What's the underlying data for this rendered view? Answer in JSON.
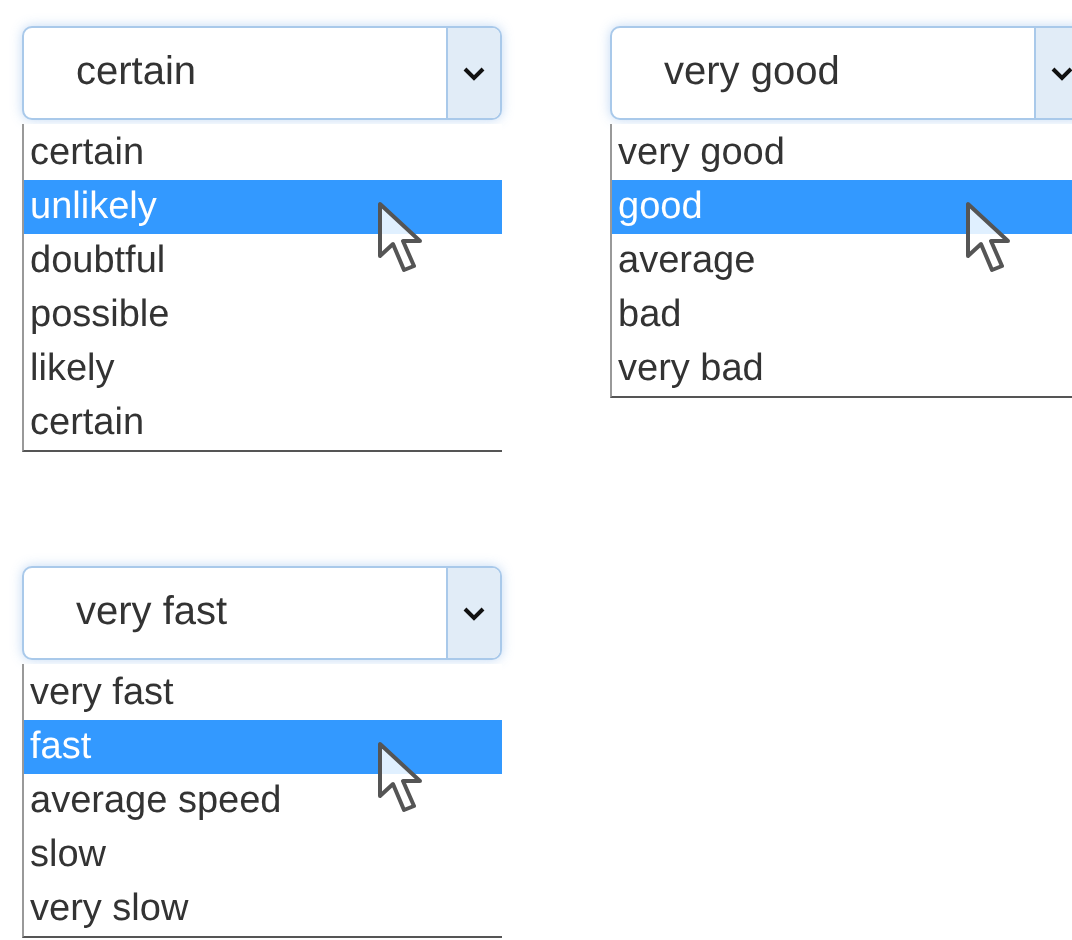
{
  "dropdowns": [
    {
      "value": "certain",
      "options": [
        {
          "label": "certain",
          "highlighted": false
        },
        {
          "label": "unlikely",
          "highlighted": true
        },
        {
          "label": "doubtful",
          "highlighted": false
        },
        {
          "label": "possible",
          "highlighted": false
        },
        {
          "label": "likely",
          "highlighted": false
        },
        {
          "label": "certain",
          "highlighted": false
        }
      ]
    },
    {
      "value": "very good",
      "options": [
        {
          "label": "very good",
          "highlighted": false
        },
        {
          "label": "good",
          "highlighted": true
        },
        {
          "label": "average",
          "highlighted": false
        },
        {
          "label": "bad",
          "highlighted": false
        },
        {
          "label": "very bad",
          "highlighted": false
        }
      ]
    },
    {
      "value": "very fast",
      "options": [
        {
          "label": "very fast",
          "highlighted": false
        },
        {
          "label": "fast",
          "highlighted": true
        },
        {
          "label": "average speed",
          "highlighted": false
        },
        {
          "label": "slow",
          "highlighted": false
        },
        {
          "label": "very slow",
          "highlighted": false
        }
      ]
    }
  ]
}
